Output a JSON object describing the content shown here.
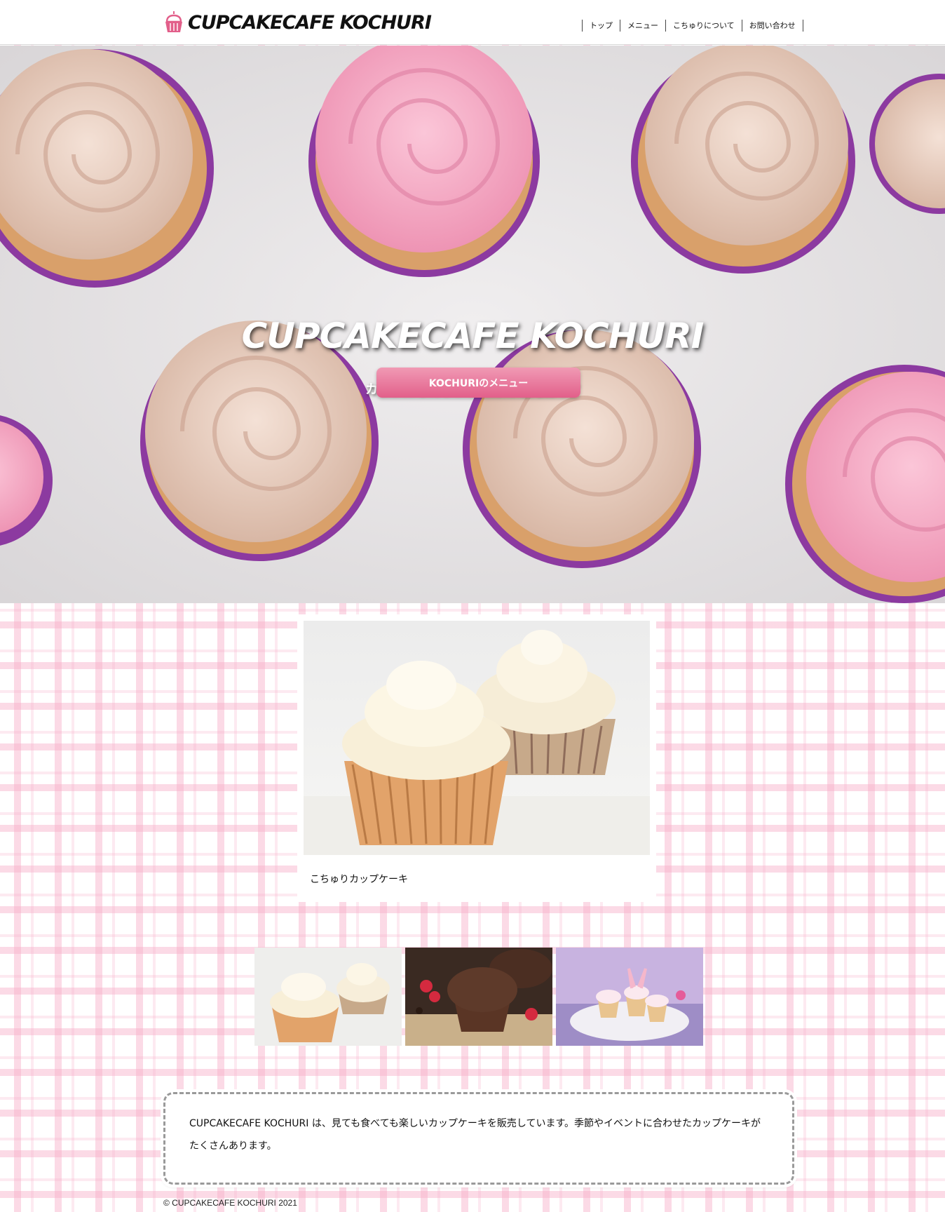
{
  "header": {
    "logo_text": "CUPCAKECAFE KOCHURI",
    "nav": [
      "トップ",
      "メニュー",
      "こちゅりについて",
      "お問い合わせ"
    ]
  },
  "hero": {
    "title": "CUPCAKECAFE KOCHURI",
    "subtitle": "カラフルなカップケーキの専門店です",
    "button_label": "KOCHURIのメニュー"
  },
  "feature": {
    "caption": "こちゅりカップケーキ"
  },
  "about": {
    "text": "CUPCAKECAFE KOCHURI は、見ても食べても楽しいカップケーキを販売しています。季節やイベントに合わせたカップケーキがたくさんあります。"
  },
  "footer": {
    "copyright": "© CUPCAKECAFE KOCHURI 2021"
  },
  "colors": {
    "brand_pink": "#e25f8a",
    "plaid_pink": "#f7adc8"
  }
}
